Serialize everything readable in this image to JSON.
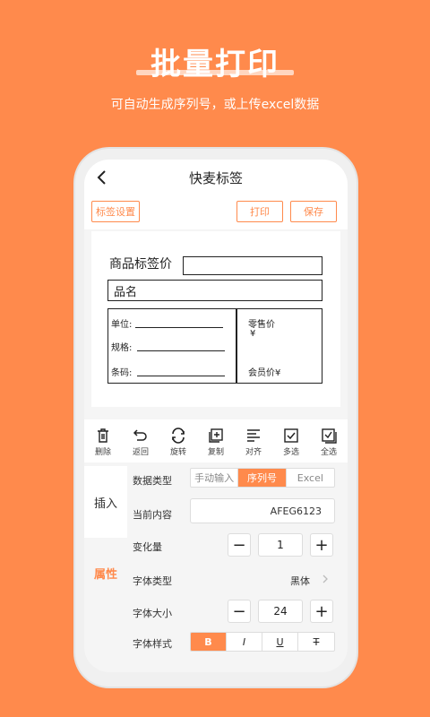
{
  "hero": {
    "title": "批量打印",
    "subtitle": "可自动生成序列号，或上传excel数据"
  },
  "nav": {
    "title": "快麦标签"
  },
  "top_buttons": {
    "settings": "标签设置",
    "print": "打印",
    "save": "保存"
  },
  "label": {
    "price_label": "商品标签价",
    "name": "品名",
    "unit": "单位:",
    "spec": "规格:",
    "barcode": "条码:",
    "retail": "零售价",
    "retail_currency": "¥",
    "member": "会员价¥"
  },
  "tools": [
    {
      "label": "删除",
      "icon": "trash-icon"
    },
    {
      "label": "返回",
      "icon": "undo-icon"
    },
    {
      "label": "旋转",
      "icon": "rotate-icon"
    },
    {
      "label": "复制",
      "icon": "copy-icon"
    },
    {
      "label": "对齐",
      "icon": "align-icon"
    },
    {
      "label": "多选",
      "icon": "checkbox-icon"
    },
    {
      "label": "全选",
      "icon": "select-all-icon"
    }
  ],
  "side": {
    "insert": "插入",
    "attributes": "属性"
  },
  "props": {
    "data_type_label": "数据类型",
    "data_type_options": [
      "手动输入",
      "序列号",
      "Excel"
    ],
    "data_type_selected": "序列号",
    "current_label": "当前内容",
    "current_value": "AFEG6123",
    "step_label": "变化量",
    "step_value": "1",
    "font_type_label": "字体类型",
    "font_type_value": "黑体",
    "font_size_label": "字体大小",
    "font_size_value": "24",
    "font_style_label": "字体样式",
    "font_style_options": [
      "B",
      "I",
      "U",
      "T"
    ],
    "minus": "−",
    "plus": "+"
  },
  "colors": {
    "accent": "#FF8A4C"
  }
}
